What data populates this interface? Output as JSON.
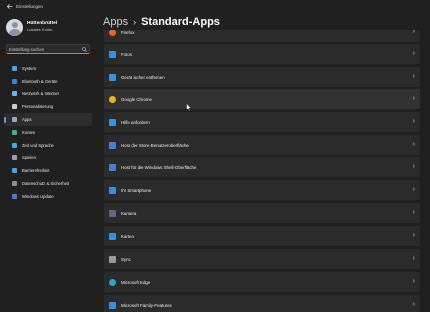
{
  "window": {
    "title": "Einstellungen"
  },
  "user": {
    "name": "Hüttenbrüttel",
    "account": "Lokales Konto"
  },
  "search": {
    "placeholder": "Einstellung suchen"
  },
  "nav": [
    {
      "label": "System",
      "icon": "monitor-icon",
      "color": "#4aa3e8"
    },
    {
      "label": "Bluetooth & Geräte",
      "icon": "bluetooth-icon",
      "color": "#3b82d6"
    },
    {
      "label": "Netzwerk & Internet",
      "icon": "wifi-icon",
      "color": "#6cb2e8"
    },
    {
      "label": "Personalisierung",
      "icon": "brush-icon",
      "color": "#c9c9c9"
    },
    {
      "label": "Apps",
      "icon": "apps-icon",
      "color": "#9aa7b8",
      "active": true
    },
    {
      "label": "Konten",
      "icon": "person-icon",
      "color": "#3fb27f"
    },
    {
      "label": "Zeit und Sprache",
      "icon": "globe-clock-icon",
      "color": "#4aa3e8"
    },
    {
      "label": "Spielen",
      "icon": "gamepad-icon",
      "color": "#9aa0a6"
    },
    {
      "label": "Barrierefreiheit",
      "icon": "accessibility-icon",
      "color": "#4aa3e8"
    },
    {
      "label": "Datenschutz & Sicherheit",
      "icon": "shield-icon",
      "color": "#8a8f98"
    },
    {
      "label": "Windows Update",
      "icon": "update-icon",
      "color": "#3b82d6"
    }
  ],
  "breadcrumb": {
    "parent": "Apps",
    "separator": "›",
    "current": "Standard-Apps"
  },
  "apps": [
    {
      "label": "Firefox",
      "icon": "firefox-icon",
      "color": "#e8652a"
    },
    {
      "label": "Fotos",
      "icon": "photos-icon",
      "color": "#3b8fd8"
    },
    {
      "label": "Gerät sicher entfernen",
      "icon": "usb-icon",
      "color": "#3b8fd8"
    },
    {
      "label": "Google Chrome",
      "icon": "chrome-icon",
      "color": "#e8b52a"
    },
    {
      "label": "Hilfe anfordern",
      "icon": "help-icon",
      "color": "#3b8fd8"
    },
    {
      "label": "Host der Store-Benutzeroberfläche",
      "icon": "store-icon",
      "color": "#4a7fd0"
    },
    {
      "label": "Host für die Windows Shell-Oberfläche",
      "icon": "shell-icon",
      "color": "#4a7fd0"
    },
    {
      "label": "Ihr Smartphone",
      "icon": "phone-icon",
      "color": "#3b8fd8"
    },
    {
      "label": "Kamera",
      "icon": "camera-icon",
      "color": "#5a6a84"
    },
    {
      "label": "Karten",
      "icon": "maps-icon",
      "color": "#3b8fd8"
    },
    {
      "label": "Sync",
      "icon": "sync-icon",
      "color": "#9a9a9a"
    },
    {
      "label": "Microsoft Edge",
      "icon": "edge-icon",
      "color": "#2ea6c9"
    },
    {
      "label": "Microsoft Family-Features",
      "icon": "family-icon",
      "color": "#3b8fd8"
    }
  ],
  "chevron": "›"
}
